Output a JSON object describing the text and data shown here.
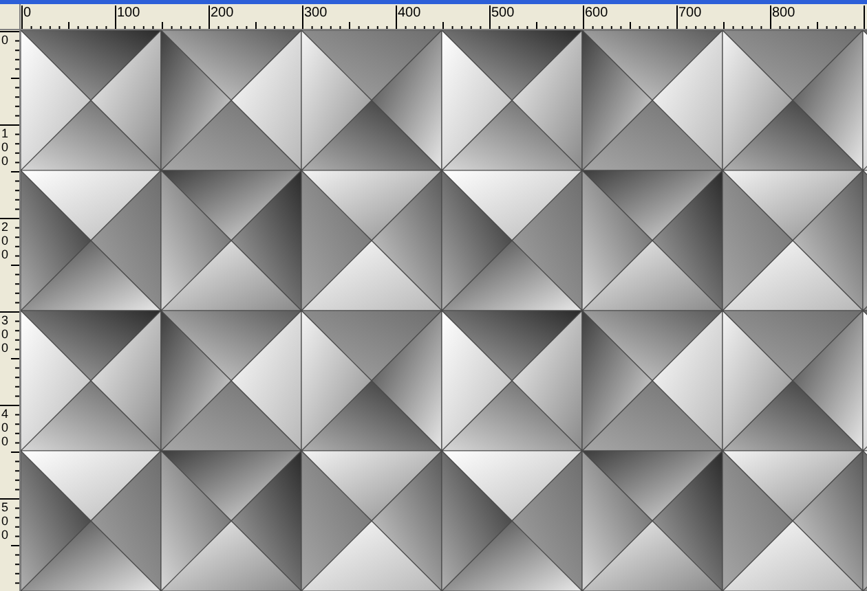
{
  "rulers": {
    "horizontal": {
      "labels": [
        "0",
        "100",
        "200",
        "300",
        "400",
        "500",
        "600",
        "700",
        "800"
      ]
    },
    "vertical": {
      "labels": [
        "0",
        "100",
        "200",
        "300",
        "400",
        "500"
      ]
    }
  }
}
